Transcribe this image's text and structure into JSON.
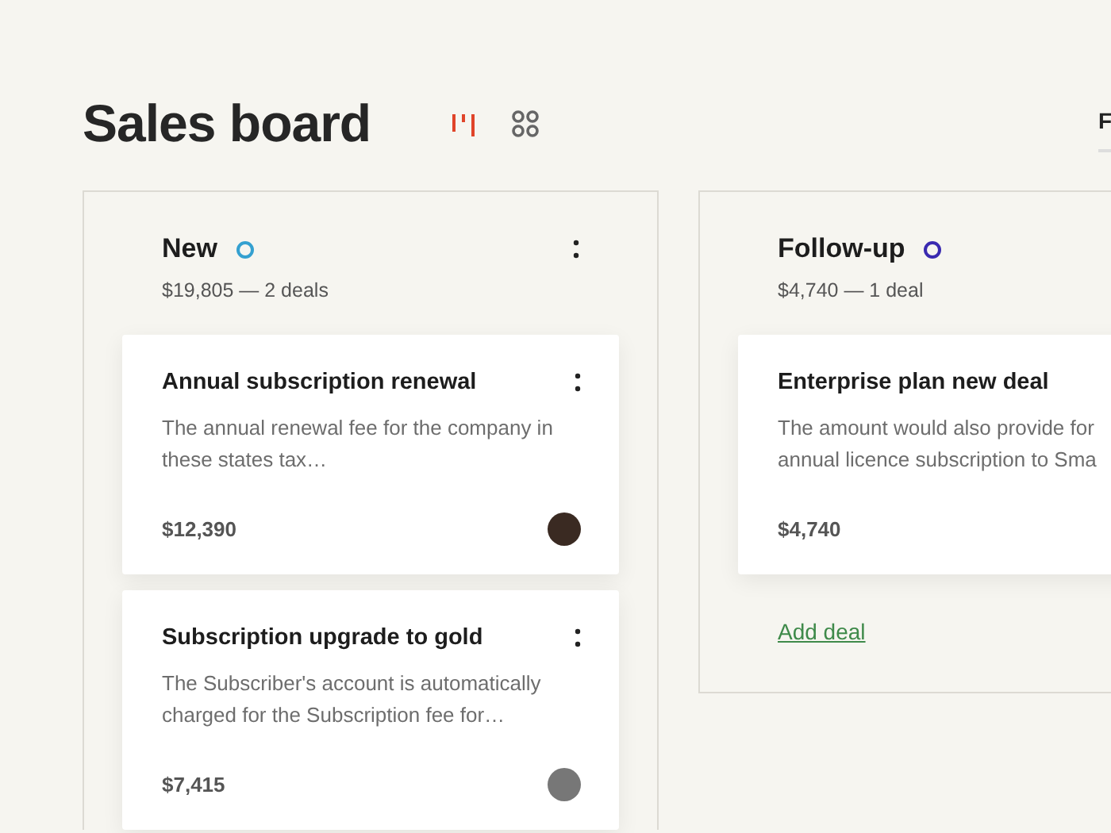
{
  "title": "Sales board",
  "views": [
    {
      "kind": "board",
      "selected": true
    },
    {
      "kind": "grid",
      "selected": false
    }
  ],
  "nav_tab": {
    "label": "F",
    "selected": true
  },
  "columns": [
    {
      "name": "New",
      "color": "#34a0d0",
      "summary": "$19,805 — 2 deals",
      "cards": [
        {
          "title": "Annual subscription renewal",
          "description": "The annual renewal fee for the company in\nthese states tax…",
          "amount": "$12,390"
        },
        {
          "title": "Subscription upgrade to gold",
          "description": "The Subscriber's account is automatically\ncharged for the Subscription fee for…",
          "amount": "$7,415"
        }
      ]
    },
    {
      "name": "Follow-up",
      "color": "#3a2ab0",
      "summary": "$4,740 — 1 deal",
      "add_link": "Add deal",
      "cards": [
        {
          "title": "Enterprise plan new deal",
          "description": "The amount would also provide for\nannual licence subscription to Sma",
          "amount": "$4,740"
        }
      ]
    }
  ]
}
